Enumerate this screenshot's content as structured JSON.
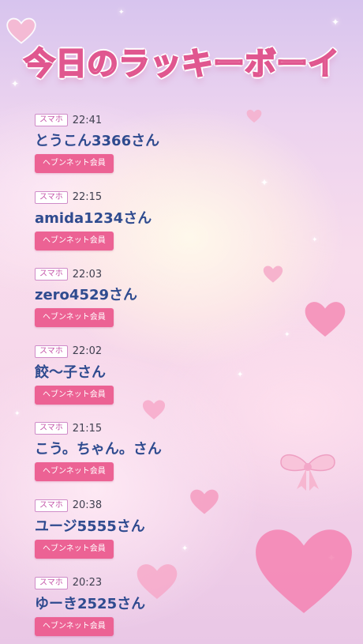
{
  "page": {
    "title": "今日のラッキーボーイ",
    "accent_color": "#ec6294",
    "title_color": "#ffc1d8",
    "name_color": "#2f4b8f"
  },
  "entries": [
    {
      "device": "スマホ",
      "time": "22:41",
      "name": "とうこん3366さん",
      "badge": "ヘブンネット会員"
    },
    {
      "device": "スマホ",
      "time": "22:15",
      "name": "amida1234さん",
      "badge": "ヘブンネット会員"
    },
    {
      "device": "スマホ",
      "time": "22:03",
      "name": "zero4529さん",
      "badge": "ヘブンネット会員"
    },
    {
      "device": "スマホ",
      "time": "22:02",
      "name": "餃～子さん",
      "badge": "ヘブンネット会員"
    },
    {
      "device": "スマホ",
      "time": "21:15",
      "name": "こう。ちゃん。さん",
      "badge": "ヘブンネット会員"
    },
    {
      "device": "スマホ",
      "time": "20:38",
      "name": "ユージ5555さん",
      "badge": "ヘブンネット会員"
    },
    {
      "device": "スマホ",
      "time": "20:23",
      "name": "ゆーき2525さん",
      "badge": "ヘブンネット会員"
    }
  ],
  "decor": {
    "heart_icon": "heart-icon",
    "sparkle_icon": "sparkle-icon"
  }
}
